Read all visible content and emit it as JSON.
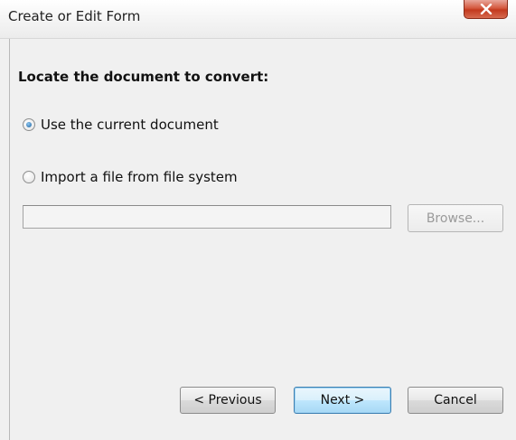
{
  "window": {
    "title": "Create or Edit Form",
    "close_label": "Close"
  },
  "main": {
    "heading": "Locate the document to convert:",
    "options": [
      {
        "label": "Use the current document",
        "selected": true
      },
      {
        "label": "Import a file from file system",
        "selected": false
      }
    ],
    "file_path": {
      "value": "",
      "placeholder": ""
    },
    "browse_label": "Browse..."
  },
  "footer": {
    "previous_label": "< Previous",
    "next_label": "Next >",
    "cancel_label": "Cancel"
  },
  "colors": {
    "accent": "#3c7fb1",
    "close_button": "#c3391e"
  },
  "icons": {
    "close": "close-icon"
  }
}
